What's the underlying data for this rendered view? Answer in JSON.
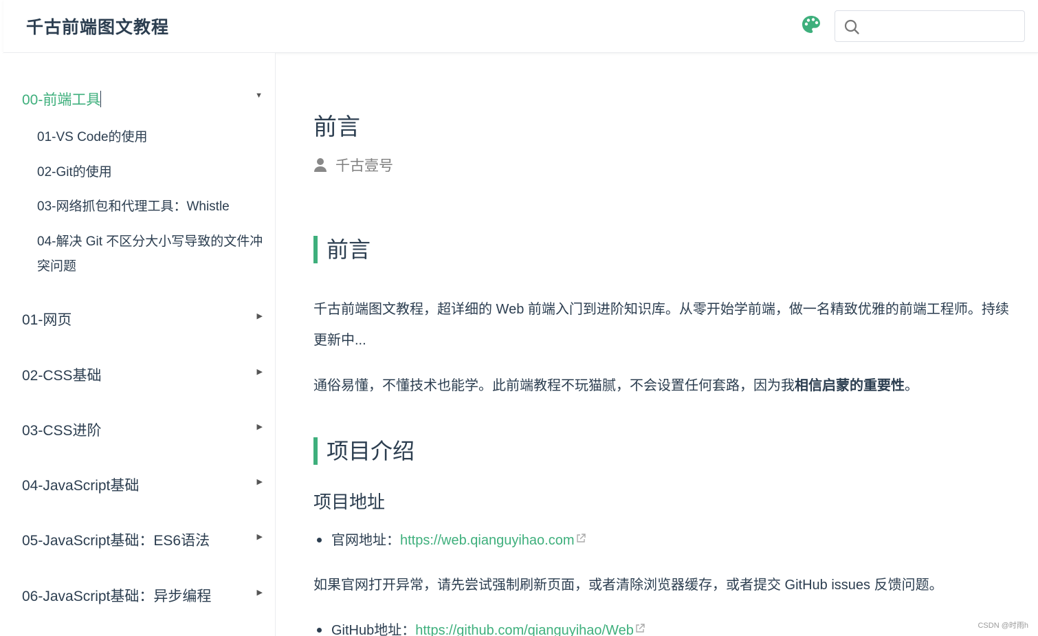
{
  "navbar": {
    "title": "千古前端图文教程",
    "palette_icon": "palette-icon",
    "search_icon": "search-icon",
    "search_value": "",
    "search_placeholder": ""
  },
  "sidebar": {
    "groups": [
      {
        "label": "00-前端工具",
        "expanded": true,
        "items": [
          "01-VS Code的使用",
          "02-Git的使用",
          "03-网络抓包和代理工具：Whistle",
          "04-解决 Git 不区分大小写导致的文件冲突问题"
        ]
      },
      {
        "label": "01-网页",
        "expanded": false
      },
      {
        "label": "02-CSS基础",
        "expanded": false
      },
      {
        "label": "03-CSS进阶",
        "expanded": false
      },
      {
        "label": "04-JavaScript基础",
        "expanded": false
      },
      {
        "label": "05-JavaScript基础：ES6语法",
        "expanded": false
      },
      {
        "label": "06-JavaScript基础：异步编程",
        "expanded": false
      }
    ]
  },
  "content": {
    "page_title": "前言",
    "author": "千古壹号",
    "section1_title": "前言",
    "intro_para": "千古前端图文教程，超详细的 Web 前端入门到进阶知识库。从零开始学前端，做一名精致优雅的前端工程师。持续更新中...",
    "para2_prefix": "通俗易懂，不懂技术也能学。此前端教程不玩猫腻，不会设置任何套路，因为我",
    "para2_bold": "相信启蒙的重要性",
    "para2_suffix": "。",
    "section2_title": "项目介绍",
    "subsection_title": "项目地址",
    "site_label": "官网地址：",
    "site_url": "https://web.qianguyihao.com",
    "notice_para": "如果官网打开异常，请先尝试强制刷新页面，或者清除浏览器缓存，或者提交 GitHub issues 反馈问题。",
    "github_label": "GitHub地址：",
    "github_url": "https://github.com/qianguyihao/Web"
  },
  "watermark": "CSDN @时雨h",
  "colors": {
    "accent": "#3eaf7c",
    "text": "#2c3e50",
    "muted": "#7f7f7f"
  }
}
